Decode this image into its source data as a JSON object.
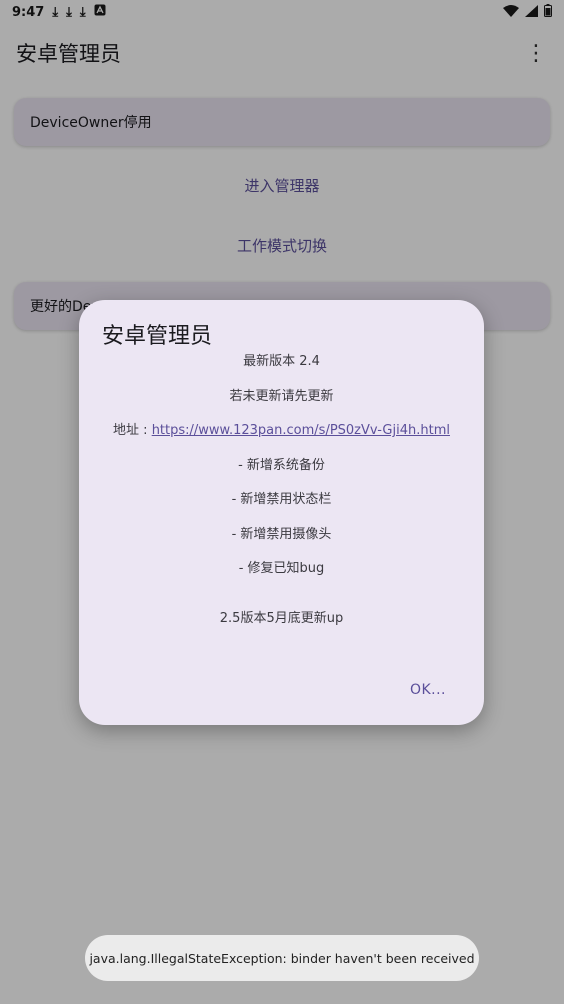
{
  "status_bar": {
    "time": "9:47",
    "left_icons": [
      "download-icon",
      "download-icon",
      "download-icon",
      "a-app-icon"
    ],
    "right_icons": [
      "wifi-icon",
      "signal-icon",
      "battery-icon"
    ]
  },
  "app_bar": {
    "title": "安卓管理员",
    "menu_icon": "more-vertical-icon"
  },
  "main": {
    "card1_label": "DeviceOwner停用",
    "button1_label": "进入管理器",
    "button2_label": "工作模式切换",
    "card2_label": "更好的Dev"
  },
  "dialog": {
    "title": "安卓管理员",
    "version": "最新版本 2.4",
    "update_prompt": "若未更新请先更新",
    "address_label": "地址 : ",
    "address_link": "https://www.123pan.com/s/PS0zVv-Gji4h.html",
    "changes": [
      "- 新增系统备份",
      "- 新增禁用状态栏",
      "- 新增禁用摄像头",
      "- 修复已知bug"
    ],
    "footer_note": "2.5版本5月底更新up",
    "ok_label": "OK..."
  },
  "toast": {
    "message": "java.lang.IllegalStateException: binder haven't been received"
  },
  "colors": {
    "accent": "#5b4f9a",
    "dialog_bg": "#ece6f3",
    "card_bg": "#e8e2ef"
  }
}
